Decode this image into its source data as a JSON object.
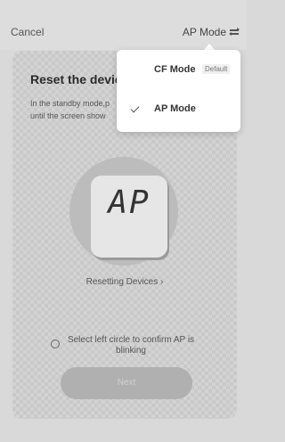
{
  "header": {
    "cancel_label": "Cancel",
    "mode_label": "AP Mode",
    "mode_icon": "swap-arrows-icon"
  },
  "card": {
    "title": "Reset the devic",
    "description_line1": "In the standby mode,p",
    "description_line2": "until the screen show",
    "display_text": "AP",
    "resetting_link": "Resetting Devices ›",
    "confirm_text": "Select left circle to confirm AP is blinking",
    "next_label": "Next"
  },
  "dropdown": {
    "items": [
      {
        "label": "CF Mode",
        "badge": "Default",
        "selected": false
      },
      {
        "label": "AP Mode",
        "badge": "",
        "selected": true
      }
    ]
  },
  "colors": {
    "background": "#d9d9d9",
    "dropdown_bg": "#ffffff",
    "next_button": "#b0b0b0"
  }
}
